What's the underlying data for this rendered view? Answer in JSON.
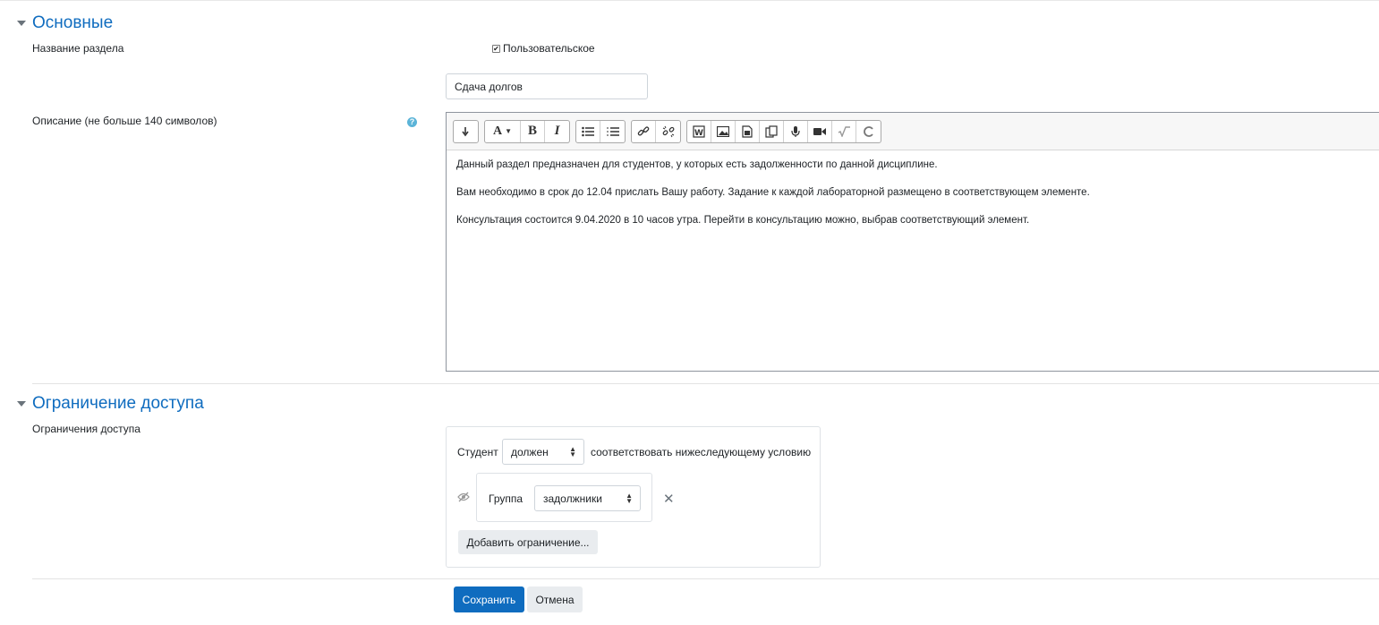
{
  "general": {
    "title": "Основные",
    "section_name_label": "Название раздела",
    "custom_checkbox_label": "Пользовательское",
    "custom_checked": true,
    "section_name_value": "Сдача долгов",
    "description_label": "Описание (не больше 140 символов)",
    "help_icon": "question-circle-icon"
  },
  "editor": {
    "toolbar_icons": [
      "collapse-toggle-icon",
      "text-style-icon",
      "bold-icon",
      "italic-icon",
      "unordered-list-icon",
      "ordered-list-icon",
      "link-icon",
      "unlink-icon",
      "word-paste-icon",
      "image-icon",
      "media-icon",
      "manage-files-icon",
      "record-audio-icon",
      "record-video-icon",
      "equation-icon",
      "undo-icon"
    ],
    "paragraphs": [
      "Данный раздел предназначен для студентов, у которых есть задолженности по данной дисциплине.",
      "Вам необходимо в срок до 12.04 прислать Вашу работу. Задание к каждой лабораторной размещено в соответствующем элементе.",
      "Консультация состоится 9.04.2020 в 10 часов утра. Перейти в консультацию можно, выбрав соответствующий элемент."
    ]
  },
  "access": {
    "title": "Ограничение доступа",
    "restrictions_label": "Ограничения доступа",
    "student_label": "Студент",
    "must_select_value": "должен",
    "condition_text": "соответствовать нижеследующему условию",
    "group_label": "Группа",
    "group_select_value": "задолжники",
    "add_restriction_label": "Добавить ограничение..."
  },
  "footer": {
    "save_label": "Сохранить",
    "cancel_label": "Отмена"
  },
  "colors": {
    "accent": "#0f6cbf",
    "help": "#5bb4d8"
  }
}
